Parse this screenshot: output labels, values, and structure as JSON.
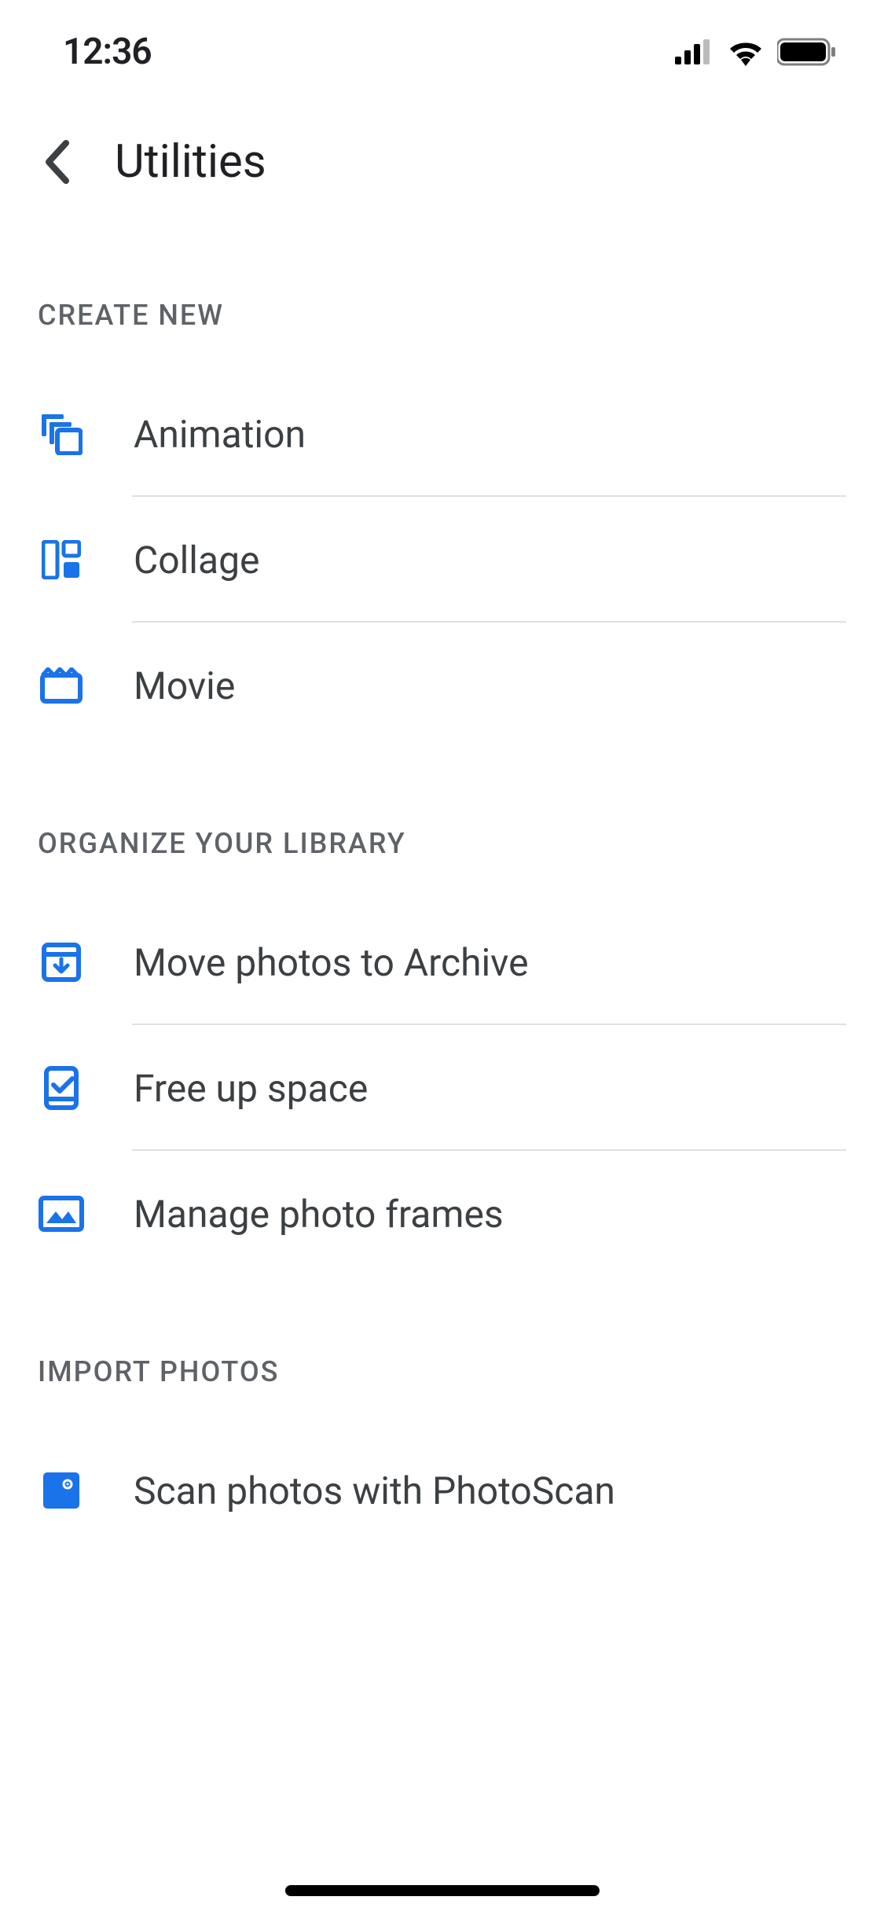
{
  "status": {
    "time": "12:36"
  },
  "header": {
    "title": "Utilities"
  },
  "sections": {
    "create": {
      "title": "CREATE NEW",
      "items": {
        "animation": "Animation",
        "collage": "Collage",
        "movie": "Movie"
      }
    },
    "organize": {
      "title": "ORGANIZE YOUR LIBRARY",
      "items": {
        "archive": "Move photos to Archive",
        "freeup": "Free up space",
        "frames": "Manage photo frames"
      }
    },
    "import": {
      "title": "IMPORT PHOTOS",
      "items": {
        "photoscan": "Scan photos with PhotoScan"
      }
    }
  },
  "colors": {
    "accent": "#1a73e8",
    "text": "#202124",
    "secondary": "#5f6368"
  }
}
